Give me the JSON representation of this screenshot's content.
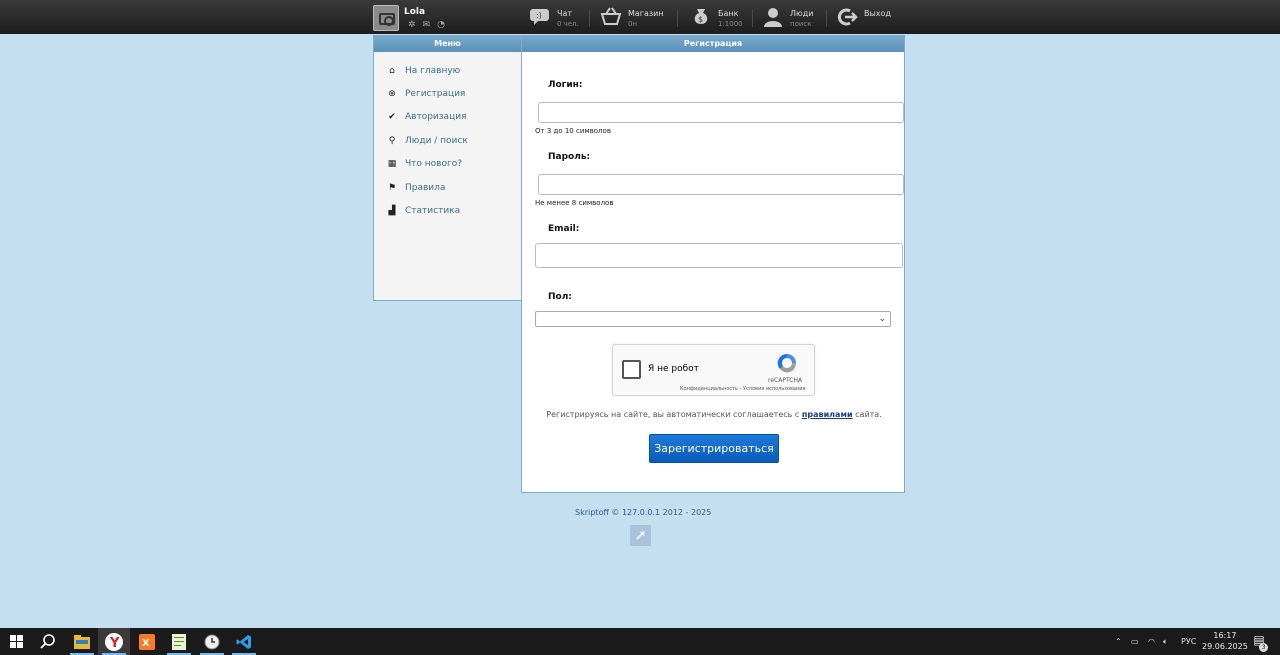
{
  "user": {
    "name": "Lola"
  },
  "nav": [
    {
      "key": "chat",
      "icon": "chat-icon",
      "title": "Чат",
      "sub": "0 чел."
    },
    {
      "key": "shop",
      "icon": "basket-icon",
      "title": "Магазин",
      "sub": "0н"
    },
    {
      "key": "bank",
      "icon": "money-bag-icon",
      "title": "Банк",
      "sub": "1:1000"
    },
    {
      "key": "people",
      "icon": "person-icon",
      "title": "Люди",
      "sub": "поиск"
    },
    {
      "key": "exit",
      "icon": "exit-icon",
      "title": "Выход",
      "sub": ""
    }
  ],
  "menu": {
    "title": "Меню",
    "items": [
      {
        "label": "На главную",
        "icon": "home-icon"
      },
      {
        "label": "Регистрация",
        "icon": "plus-circle-icon"
      },
      {
        "label": "Авторизация",
        "icon": "checkmark-icon"
      },
      {
        "label": "Люди / поиск",
        "icon": "search-icon"
      },
      {
        "label": "Что нового?",
        "icon": "calendar-icon"
      },
      {
        "label": "Правила",
        "icon": "flag-icon"
      },
      {
        "label": "Статистика",
        "icon": "signal-bars-icon"
      }
    ]
  },
  "form": {
    "title": "Регистрация",
    "login_label": "Логин:",
    "login_value": "",
    "login_hint": "От 3 до 10 символов",
    "password_label": "Пароль:",
    "password_value": "",
    "password_hint": "Не менее 8 символов",
    "email_label": "Email:",
    "email_value": "",
    "gender_label": "Пол:",
    "gender_value": "",
    "captcha_text": "Я не робот",
    "captcha_brand": "reCAPTCHA",
    "captcha_terms": "Конфиденциальность - Условия использования",
    "agree_before": "Регистрируясь на сайте, вы автоматически соглашаетесь с ",
    "agree_link": "правилами",
    "agree_after": " сайта.",
    "submit_label": "Зарегистрироваться"
  },
  "footer": {
    "site": "Skriptoff",
    "copy": "©",
    "host": "127.0.0.1",
    "years": "2012 - 2025"
  },
  "taskbar": {
    "lang": "РУС",
    "time": "16:17",
    "date": "29.06.2025",
    "notifications": "3"
  }
}
